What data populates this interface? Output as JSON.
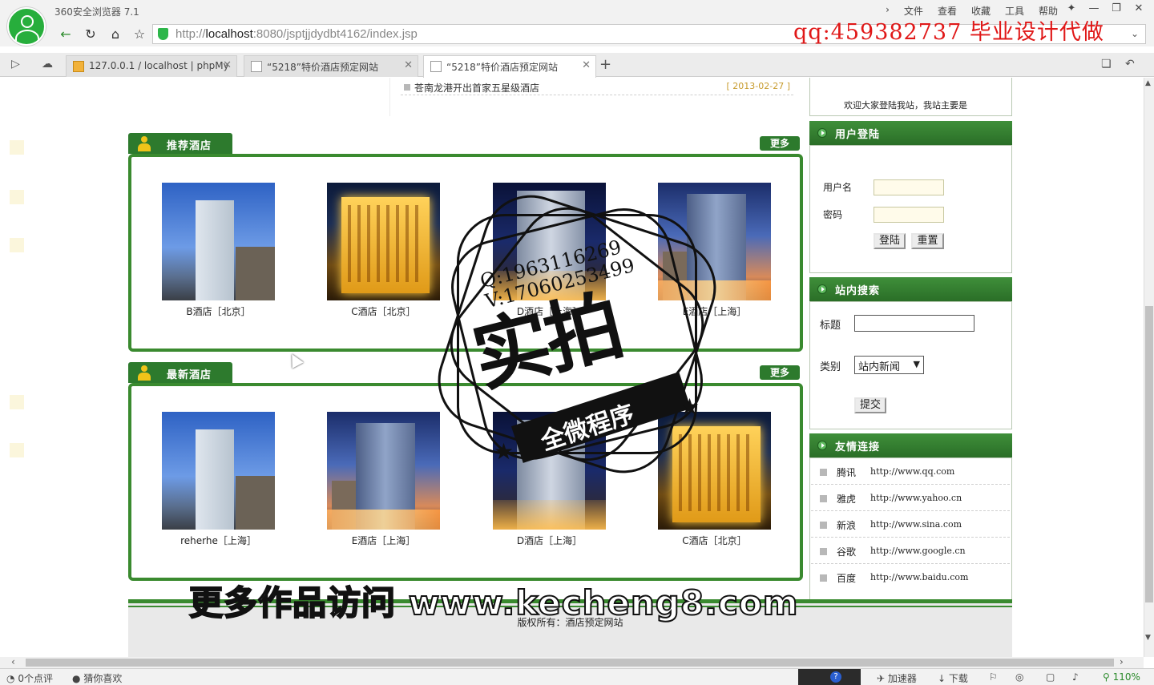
{
  "browser": {
    "app_title": "360安全浏览器 7.1",
    "menu": [
      "文件",
      "查看",
      "收藏",
      "工具",
      "帮助"
    ],
    "url_prefix": "http://",
    "url_host": "localhost",
    "url_rest": ":8080/jsptjjdydbt4162/index.jsp",
    "qq_overlay": "qq:459382737 毕业设计代做",
    "tabs": [
      {
        "label": "127.0.0.1 / localhost | phpMy"
      },
      {
        "label": "“5218”特价酒店预定网站"
      },
      {
        "label": "“5218”特价酒店预定网站"
      }
    ]
  },
  "news": {
    "title": "苍南龙港开出首家五星级酒店",
    "date": "[ 2013-02-27 ]"
  },
  "welcome_text": "欢迎大家登陆我站，我站主要是",
  "recommended": {
    "title": "推荐酒店",
    "more": "更多",
    "hotels": [
      {
        "name": "B酒店［北京］"
      },
      {
        "name": "C酒店［北京］"
      },
      {
        "name": "D酒店［上海］"
      },
      {
        "name": "E酒店［上海］"
      }
    ]
  },
  "latest": {
    "title": "最新酒店",
    "more": "更多",
    "hotels": [
      {
        "name": "reherhe［上海］"
      },
      {
        "name": "E酒店［上海］"
      },
      {
        "name": "D酒店［上海］"
      },
      {
        "name": "C酒店［北京］"
      }
    ]
  },
  "login": {
    "title": "用户登陆",
    "username_label": "用户名",
    "password_label": "密码",
    "login_button": "登陆",
    "reset_button": "重置"
  },
  "search": {
    "title": "站内搜索",
    "title_label": "标题",
    "category_label": "类别",
    "category_value": "站内新闻",
    "submit": "提交"
  },
  "links": {
    "title": "友情连接",
    "items": [
      {
        "name": "腾讯",
        "url": "http://www.qq.com"
      },
      {
        "name": "雅虎",
        "url": "http://www.yahoo.cn"
      },
      {
        "name": "新浪",
        "url": "http://www.sina.com"
      },
      {
        "name": "谷歌",
        "url": "http://www.google.cn"
      },
      {
        "name": "百度",
        "url": "http://www.baidu.com"
      }
    ]
  },
  "footer": {
    "copyright": "版权所有：酒店预定网站"
  },
  "watermark": {
    "contact_line1": "Q:1963116269",
    "contact_line2": "V:17060253499",
    "big_text": "实拍",
    "banner_text": "全微程序",
    "caption": "更多作品访问 www.kecheng8.com"
  },
  "statusbar": {
    "reviews": "0个点评",
    "guess": "猜你喜欢",
    "accelerator": "加速器",
    "download": "下载",
    "zoom": "110%"
  }
}
